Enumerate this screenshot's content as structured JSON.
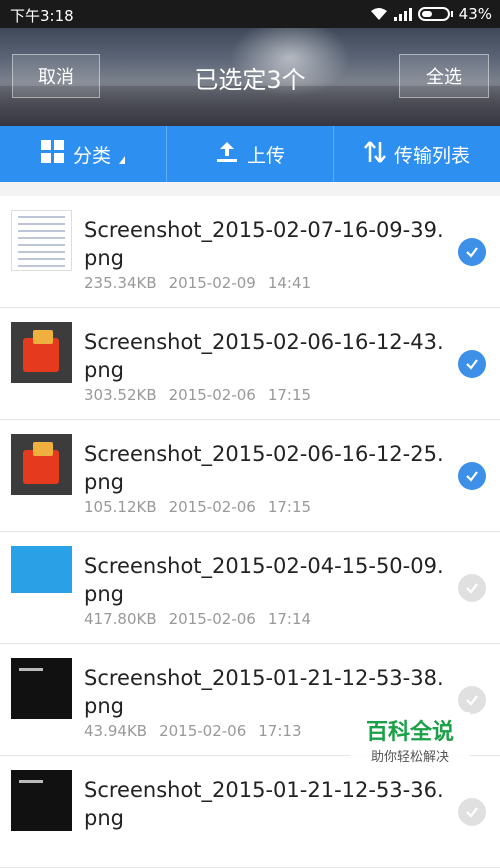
{
  "status": {
    "time": "下午3:18",
    "battery": "43%",
    "battery_level": 0.43
  },
  "header": {
    "cancel_label": "取消",
    "title": "已选定3个",
    "select_all_label": "全选"
  },
  "toolbar": {
    "category_label": "分类",
    "upload_label": "上传",
    "transfers_label": "传输列表"
  },
  "files": [
    {
      "name": "Screenshot_2015-02-07-16-09-39.png",
      "size": "235.34KB",
      "date": "2015-02-09",
      "time": "14:41",
      "selected": true,
      "thumb": "doc"
    },
    {
      "name": "Screenshot_2015-02-06-16-12-43.png",
      "size": "303.52KB",
      "date": "2015-02-06",
      "time": "17:15",
      "selected": true,
      "thumb": "red"
    },
    {
      "name": "Screenshot_2015-02-06-16-12-25.png",
      "size": "105.12KB",
      "date": "2015-02-06",
      "time": "17:15",
      "selected": true,
      "thumb": "red"
    },
    {
      "name": "Screenshot_2015-02-04-15-50-09.png",
      "size": "417.80KB",
      "date": "2015-02-06",
      "time": "17:14",
      "selected": false,
      "thumb": "blue"
    },
    {
      "name": "Screenshot_2015-01-21-12-53-38.png",
      "size": "43.94KB",
      "date": "2015-02-06",
      "time": "17:13",
      "selected": false,
      "thumb": "dark"
    },
    {
      "name": "Screenshot_2015-01-21-12-53-36.png",
      "size": "",
      "date": "",
      "time": "",
      "selected": false,
      "thumb": "dark"
    }
  ],
  "watermark": {
    "title": "百科全说",
    "subtitle": "助你轻松解决"
  },
  "colors": {
    "accent": "#2d8ff0",
    "check": "#3d8fe8"
  }
}
